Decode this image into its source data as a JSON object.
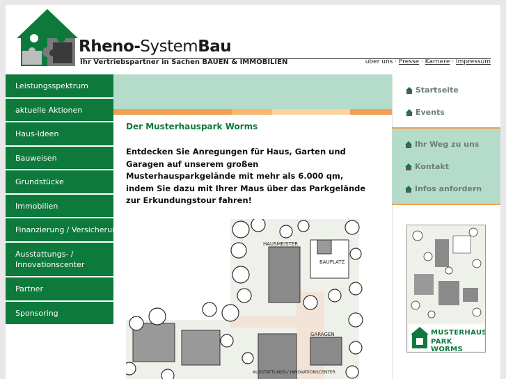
{
  "header": {
    "brand_part1": "Rheno-",
    "brand_part2": "System",
    "brand_part3": "Bau",
    "tagline": "Ihr Vertriebspartner in Sachen BAUEN & IMMOBILIEN",
    "links": {
      "ueber_uns": "über uns",
      "presse": "Presse",
      "karriere": "Karriere",
      "impressum": "Impressum",
      "separator": " · "
    }
  },
  "leftnav": {
    "items": [
      {
        "label": "Leistungsspektrum"
      },
      {
        "label": "aktuelle Aktionen"
      },
      {
        "label": "Haus-Ideen"
      },
      {
        "label": "Bauweisen"
      },
      {
        "label": "Grundstücke"
      },
      {
        "label": "Immobilien"
      },
      {
        "label": "Finanzierung / Versicherung"
      },
      {
        "label": "Ausstattungs- / Innovationscenter"
      },
      {
        "label": "Partner"
      },
      {
        "label": "Sponsoring"
      }
    ]
  },
  "main": {
    "title": "Der Musterhauspark Worms",
    "intro": "Entdecken Sie Anregungen für Haus, Garten und Garagen auf unserem großen Musterhausparkgelände mit mehr als 6.000 qm, indem Sie dazu mit Ihrer Maus über das Parkgelände zur Erkundungstour fahren!",
    "plan_labels": {
      "hausmeister": "HAUSMEISTER",
      "bauplatz": "BAUPLATZ",
      "garagen": "GARAGEN",
      "center": "AUSSTATTUNGS-/ INNOVATIONSCENTER"
    }
  },
  "rightnav": {
    "links1": [
      {
        "label": "Startseite"
      },
      {
        "label": "Events"
      }
    ],
    "links2": [
      {
        "label": "Ihr Weg zu uns"
      },
      {
        "label": "Kontakt"
      },
      {
        "label": "Infos anfordern"
      }
    ]
  },
  "ad": {
    "line1": "MUSTERHAUS",
    "line2": "PARK WORMS"
  },
  "colors": {
    "brand_green": "#0d7a3c",
    "light_green": "#b5dccb",
    "orange": "#f0a050"
  }
}
